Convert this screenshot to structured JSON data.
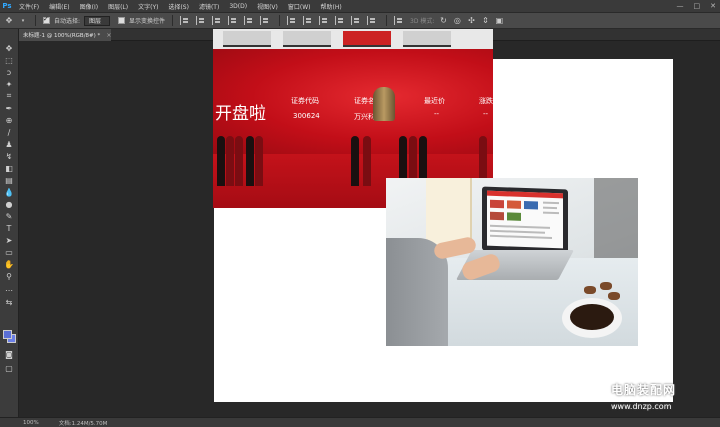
{
  "app": {
    "logo": "Ps"
  },
  "menu": [
    "文件(F)",
    "编辑(E)",
    "图像(I)",
    "图层(L)",
    "文字(Y)",
    "选择(S)",
    "滤镜(T)",
    "3D(D)",
    "视图(V)",
    "窗口(W)",
    "帮助(H)"
  ],
  "window_controls": {
    "minimize": "—",
    "maximize": "□",
    "close": "✕"
  },
  "options_bar": {
    "auto_select_label": "自动选择:",
    "auto_select_value": "图层",
    "show_transform_label": "显示变换控件",
    "mode_3d_label": "3D 模式:"
  },
  "document_tab": {
    "title": "未标题-1 @ 100%(RGB/8#) *",
    "close": "×"
  },
  "photo1": {
    "headline": "开盘啦",
    "code_label": "证券代码",
    "code_value": "300624",
    "name_label": "证券名",
    "name_value": "万兴科",
    "price_label": "最近价",
    "price_value": "--",
    "change_label": "涨跌",
    "change_value": "--"
  },
  "status": {
    "zoom": "100%",
    "doc_size": "文档:1.24M/5.70M"
  },
  "watermark": {
    "cn": "电脑装配网",
    "url": "www.dnzp.com"
  },
  "colors": {
    "foreground": "#5a6fd6",
    "background": "#6b7fe6",
    "ps_blue": "#31a8ff"
  }
}
